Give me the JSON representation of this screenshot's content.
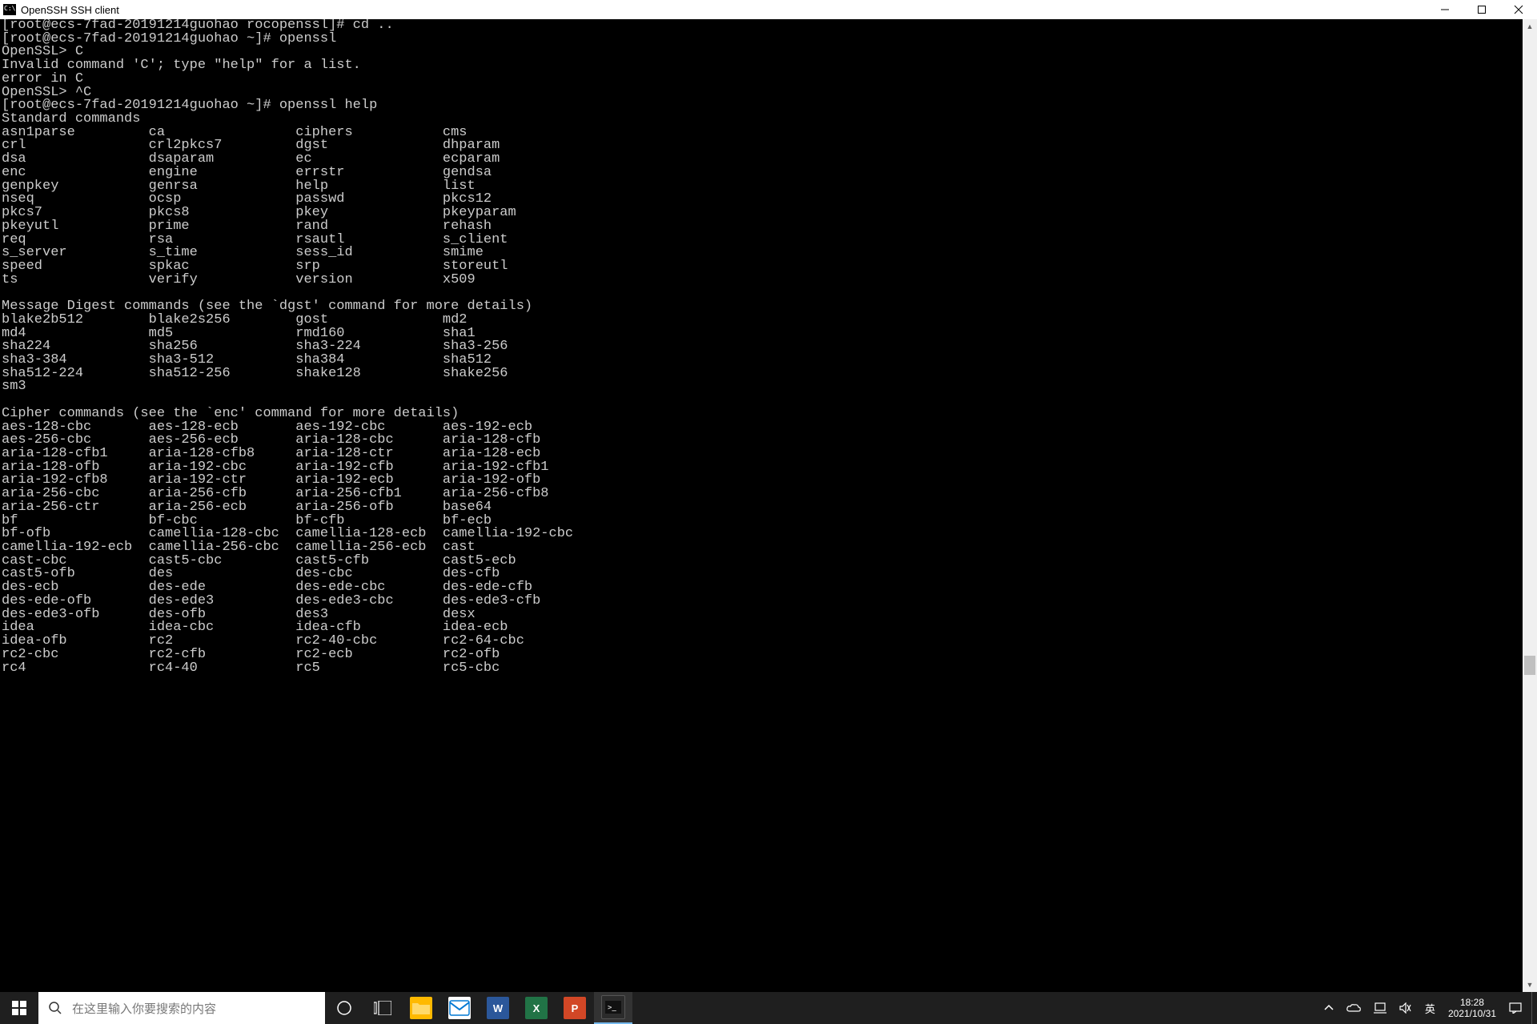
{
  "window": {
    "title": "OpenSSH SSH client"
  },
  "prelude": [
    "[root@ecs-7fad-20191214guohao rocopenssl]# cd ..",
    "[root@ecs-7fad-20191214guohao ~]# openssl",
    "OpenSSL> C",
    "Invalid command 'C'; type \"help\" for a list.",
    "error in C",
    "OpenSSL> ^C",
    "[root@ecs-7fad-20191214guohao ~]# openssl help"
  ],
  "sections": {
    "standard": {
      "header": "Standard commands",
      "cols": [
        [
          "asn1parse",
          "ca",
          "ciphers",
          "cms"
        ],
        [
          "crl",
          "crl2pkcs7",
          "dgst",
          "dhparam"
        ],
        [
          "dsa",
          "dsaparam",
          "ec",
          "ecparam"
        ],
        [
          "enc",
          "engine",
          "errstr",
          "gendsa"
        ],
        [
          "genpkey",
          "genrsa",
          "help",
          "list"
        ],
        [
          "nseq",
          "ocsp",
          "passwd",
          "pkcs12"
        ],
        [
          "pkcs7",
          "pkcs8",
          "pkey",
          "pkeyparam"
        ],
        [
          "pkeyutl",
          "prime",
          "rand",
          "rehash"
        ],
        [
          "req",
          "rsa",
          "rsautl",
          "s_client"
        ],
        [
          "s_server",
          "s_time",
          "sess_id",
          "smime"
        ],
        [
          "speed",
          "spkac",
          "srp",
          "storeutl"
        ],
        [
          "ts",
          "verify",
          "version",
          "x509"
        ]
      ]
    },
    "digest": {
      "header": "Message Digest commands (see the `dgst' command for more details)",
      "cols": [
        [
          "blake2b512",
          "blake2s256",
          "gost",
          "md2"
        ],
        [
          "md4",
          "md5",
          "rmd160",
          "sha1"
        ],
        [
          "sha224",
          "sha256",
          "sha3-224",
          "sha3-256"
        ],
        [
          "sha3-384",
          "sha3-512",
          "sha384",
          "sha512"
        ],
        [
          "sha512-224",
          "sha512-256",
          "shake128",
          "shake256"
        ],
        [
          "sm3",
          "",
          "",
          ""
        ]
      ]
    },
    "cipher": {
      "header": "Cipher commands (see the `enc' command for more details)",
      "cols": [
        [
          "aes-128-cbc",
          "aes-128-ecb",
          "aes-192-cbc",
          "aes-192-ecb"
        ],
        [
          "aes-256-cbc",
          "aes-256-ecb",
          "aria-128-cbc",
          "aria-128-cfb"
        ],
        [
          "aria-128-cfb1",
          "aria-128-cfb8",
          "aria-128-ctr",
          "aria-128-ecb"
        ],
        [
          "aria-128-ofb",
          "aria-192-cbc",
          "aria-192-cfb",
          "aria-192-cfb1"
        ],
        [
          "aria-192-cfb8",
          "aria-192-ctr",
          "aria-192-ecb",
          "aria-192-ofb"
        ],
        [
          "aria-256-cbc",
          "aria-256-cfb",
          "aria-256-cfb1",
          "aria-256-cfb8"
        ],
        [
          "aria-256-ctr",
          "aria-256-ecb",
          "aria-256-ofb",
          "base64"
        ],
        [
          "bf",
          "bf-cbc",
          "bf-cfb",
          "bf-ecb"
        ],
        [
          "bf-ofb",
          "camellia-128-cbc",
          "camellia-128-ecb",
          "camellia-192-cbc"
        ],
        [
          "camellia-192-ecb",
          "camellia-256-cbc",
          "camellia-256-ecb",
          "cast"
        ],
        [
          "cast-cbc",
          "cast5-cbc",
          "cast5-cfb",
          "cast5-ecb"
        ],
        [
          "cast5-ofb",
          "des",
          "des-cbc",
          "des-cfb"
        ],
        [
          "des-ecb",
          "des-ede",
          "des-ede-cbc",
          "des-ede-cfb"
        ],
        [
          "des-ede-ofb",
          "des-ede3",
          "des-ede3-cbc",
          "des-ede3-cfb"
        ],
        [
          "des-ede3-ofb",
          "des-ofb",
          "des3",
          "desx"
        ],
        [
          "idea",
          "idea-cbc",
          "idea-cfb",
          "idea-ecb"
        ],
        [
          "idea-ofb",
          "rc2",
          "rc2-40-cbc",
          "rc2-64-cbc"
        ],
        [
          "rc2-cbc",
          "rc2-cfb",
          "rc2-ecb",
          "rc2-ofb"
        ],
        [
          "rc4",
          "rc4-40",
          "rc5",
          "rc5-cbc"
        ]
      ]
    }
  },
  "taskbar": {
    "search_placeholder": "在这里输入你要搜索的内容",
    "ime": "英",
    "time": "18:28",
    "date": "2021/10/31"
  }
}
